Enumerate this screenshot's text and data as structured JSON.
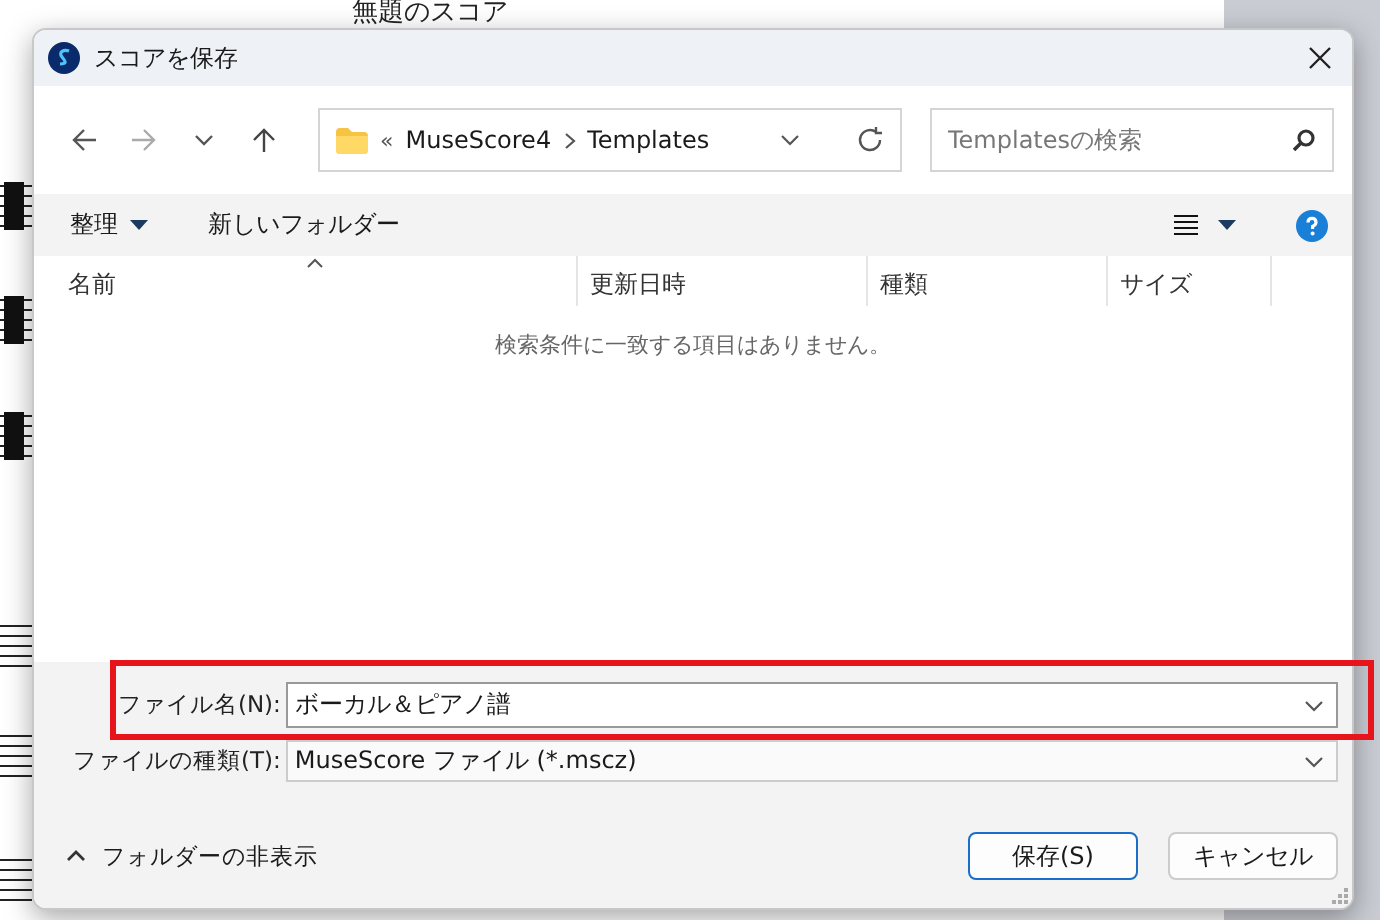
{
  "background": {
    "score_title": "無題のスコア"
  },
  "window": {
    "title": "スコアを保存"
  },
  "address": {
    "prefix": "«",
    "parts": [
      "MuseScore4",
      "Templates"
    ]
  },
  "search": {
    "placeholder": "Templatesの検索"
  },
  "toolbar": {
    "organize": "整理",
    "new_folder": "新しいフォルダー"
  },
  "table": {
    "columns": [
      {
        "label": "名前",
        "sorted": true
      },
      {
        "label": "更新日時",
        "sorted": false
      },
      {
        "label": "種類",
        "sorted": false
      },
      {
        "label": "サイズ",
        "sorted": false
      }
    ],
    "empty_message": "検索条件に一致する項目はありません。"
  },
  "file_name": {
    "label": "ファイル名(N):",
    "value": "ボーカル＆ピアノ譜",
    "highlighted": true
  },
  "file_type": {
    "label": "ファイルの種類(T):",
    "value": "MuseScore ファイル (*.mscz)"
  },
  "hide_folders": "フォルダーの非表示",
  "buttons": [
    {
      "label": "保存(S)",
      "default": true
    },
    {
      "label": "キャンセル",
      "default": false
    }
  ]
}
